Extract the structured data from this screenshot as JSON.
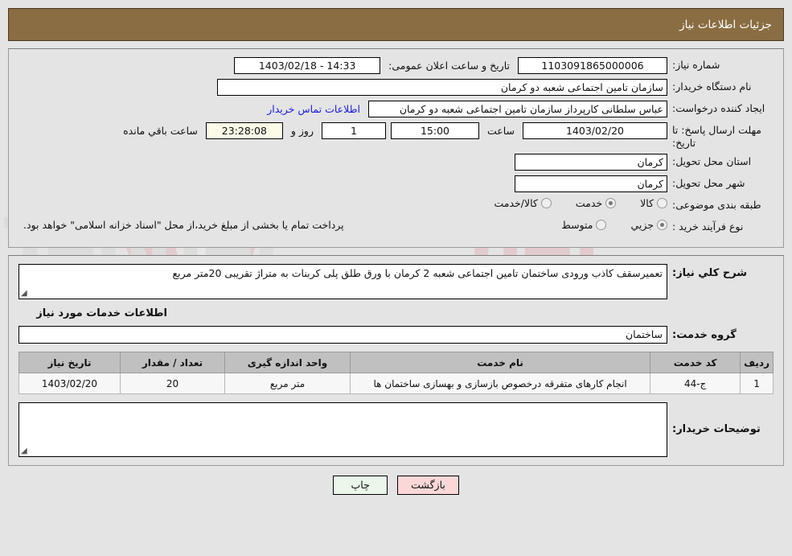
{
  "header": {
    "title": "جزئیات اطلاعات نیاز"
  },
  "details": {
    "need_number_label": "شماره نیاز:",
    "need_number_value": "1103091865000006",
    "announce_label": "تاریخ و ساعت اعلان عمومی:",
    "announce_value": "14:33 - 1403/02/18",
    "buyer_org_label": "نام دستگاه خریدار:",
    "buyer_org_value": "سازمان تامین اجتماعی شعبه دو کرمان",
    "creator_label": "ایجاد کننده درخواست:",
    "creator_value": "عباس سلطانی کارپرداز سازمان تامین اجتماعی شعبه دو کرمان",
    "contact_link": "اطلاعات تماس خریدار",
    "deadline_label": "مهلت ارسال پاسخ: تا تاریخ:",
    "deadline_date": "1403/02/20",
    "clock_label": "ساعت",
    "deadline_time": "15:00",
    "days_value": "1",
    "days_unit": "روز و",
    "countdown_value": "23:28:08",
    "remaining_label": "ساعت باقي مانده",
    "province_label": "استان محل تحویل:",
    "province_value": "کرمان",
    "city_label": "شهر محل تحویل:",
    "city_value": "کرمان",
    "category_label": "طبقه بندی موضوعی:",
    "category_options": [
      {
        "label": "کالا",
        "selected": false
      },
      {
        "label": "خدمت",
        "selected": true
      },
      {
        "label": "کالا/خدمت",
        "selected": false
      }
    ],
    "process_label": "نوع فرآیند خرید :",
    "process_options": [
      {
        "label": "جزیي",
        "selected": true
      },
      {
        "label": "متوسط",
        "selected": false
      }
    ],
    "payment_note": "پرداخت تمام یا بخشی از مبلغ خرید،از محل \"اسناد خزانه اسلامی\" خواهد بود."
  },
  "description": {
    "label": "شرح کلي نیاز:",
    "value": "تعمیرسقف کاذب ورودی ساختمان تامین اجتماعی شعبه 2 کرمان با ورق طلق پلی کربنات به متراژ تقریبی 20متر مربع"
  },
  "services": {
    "section_title": "اطلاعات خدمات مورد نیاز",
    "group_label": "گروه خدمت:",
    "group_value": "ساختمان",
    "columns": [
      "ردیف",
      "کد خدمت",
      "نام خدمت",
      "واحد اندازه گیری",
      "تعداد / مقدار",
      "تاریخ نیاز"
    ],
    "rows": [
      {
        "index": "1",
        "code": "ج-44",
        "name": "انجام کارهای متفرقه درخصوص بازسازی و بهسازی ساختمان ها",
        "unit": "متر مربع",
        "quantity": "20",
        "date": "1403/02/20"
      }
    ]
  },
  "buyer_notes": {
    "label": "توضیحات خریدار:",
    "value": ""
  },
  "footer": {
    "print_label": "چاپ",
    "back_label": "بازگشت"
  },
  "colors": {
    "header_bar": "#8a6d42",
    "link": "#1a1ae0",
    "print_button": "#eaf7ea",
    "back_button": "#fbd7d7",
    "countdown_field": "#fbfbe8",
    "table_header": "#c0c0c0"
  }
}
